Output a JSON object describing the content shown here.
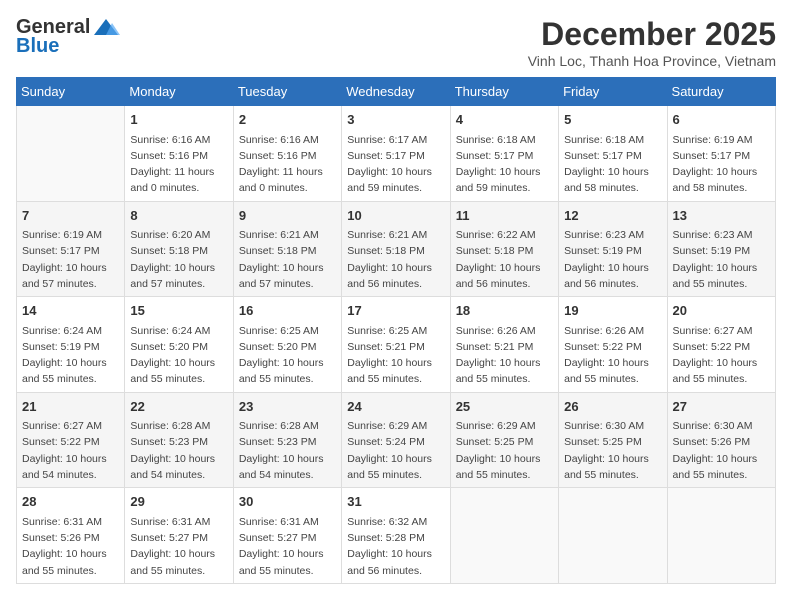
{
  "header": {
    "logo_general": "General",
    "logo_blue": "Blue",
    "month_title": "December 2025",
    "subtitle": "Vinh Loc, Thanh Hoa Province, Vietnam"
  },
  "days_of_week": [
    "Sunday",
    "Monday",
    "Tuesday",
    "Wednesday",
    "Thursday",
    "Friday",
    "Saturday"
  ],
  "weeks": [
    [
      {
        "day": "",
        "info": ""
      },
      {
        "day": "1",
        "info": "Sunrise: 6:16 AM\nSunset: 5:16 PM\nDaylight: 11 hours\nand 0 minutes."
      },
      {
        "day": "2",
        "info": "Sunrise: 6:16 AM\nSunset: 5:16 PM\nDaylight: 11 hours\nand 0 minutes."
      },
      {
        "day": "3",
        "info": "Sunrise: 6:17 AM\nSunset: 5:17 PM\nDaylight: 10 hours\nand 59 minutes."
      },
      {
        "day": "4",
        "info": "Sunrise: 6:18 AM\nSunset: 5:17 PM\nDaylight: 10 hours\nand 59 minutes."
      },
      {
        "day": "5",
        "info": "Sunrise: 6:18 AM\nSunset: 5:17 PM\nDaylight: 10 hours\nand 58 minutes."
      },
      {
        "day": "6",
        "info": "Sunrise: 6:19 AM\nSunset: 5:17 PM\nDaylight: 10 hours\nand 58 minutes."
      }
    ],
    [
      {
        "day": "7",
        "info": "Sunrise: 6:19 AM\nSunset: 5:17 PM\nDaylight: 10 hours\nand 57 minutes."
      },
      {
        "day": "8",
        "info": "Sunrise: 6:20 AM\nSunset: 5:18 PM\nDaylight: 10 hours\nand 57 minutes."
      },
      {
        "day": "9",
        "info": "Sunrise: 6:21 AM\nSunset: 5:18 PM\nDaylight: 10 hours\nand 57 minutes."
      },
      {
        "day": "10",
        "info": "Sunrise: 6:21 AM\nSunset: 5:18 PM\nDaylight: 10 hours\nand 56 minutes."
      },
      {
        "day": "11",
        "info": "Sunrise: 6:22 AM\nSunset: 5:18 PM\nDaylight: 10 hours\nand 56 minutes."
      },
      {
        "day": "12",
        "info": "Sunrise: 6:23 AM\nSunset: 5:19 PM\nDaylight: 10 hours\nand 56 minutes."
      },
      {
        "day": "13",
        "info": "Sunrise: 6:23 AM\nSunset: 5:19 PM\nDaylight: 10 hours\nand 55 minutes."
      }
    ],
    [
      {
        "day": "14",
        "info": "Sunrise: 6:24 AM\nSunset: 5:19 PM\nDaylight: 10 hours\nand 55 minutes."
      },
      {
        "day": "15",
        "info": "Sunrise: 6:24 AM\nSunset: 5:20 PM\nDaylight: 10 hours\nand 55 minutes."
      },
      {
        "day": "16",
        "info": "Sunrise: 6:25 AM\nSunset: 5:20 PM\nDaylight: 10 hours\nand 55 minutes."
      },
      {
        "day": "17",
        "info": "Sunrise: 6:25 AM\nSunset: 5:21 PM\nDaylight: 10 hours\nand 55 minutes."
      },
      {
        "day": "18",
        "info": "Sunrise: 6:26 AM\nSunset: 5:21 PM\nDaylight: 10 hours\nand 55 minutes."
      },
      {
        "day": "19",
        "info": "Sunrise: 6:26 AM\nSunset: 5:22 PM\nDaylight: 10 hours\nand 55 minutes."
      },
      {
        "day": "20",
        "info": "Sunrise: 6:27 AM\nSunset: 5:22 PM\nDaylight: 10 hours\nand 55 minutes."
      }
    ],
    [
      {
        "day": "21",
        "info": "Sunrise: 6:27 AM\nSunset: 5:22 PM\nDaylight: 10 hours\nand 54 minutes."
      },
      {
        "day": "22",
        "info": "Sunrise: 6:28 AM\nSunset: 5:23 PM\nDaylight: 10 hours\nand 54 minutes."
      },
      {
        "day": "23",
        "info": "Sunrise: 6:28 AM\nSunset: 5:23 PM\nDaylight: 10 hours\nand 54 minutes."
      },
      {
        "day": "24",
        "info": "Sunrise: 6:29 AM\nSunset: 5:24 PM\nDaylight: 10 hours\nand 55 minutes."
      },
      {
        "day": "25",
        "info": "Sunrise: 6:29 AM\nSunset: 5:25 PM\nDaylight: 10 hours\nand 55 minutes."
      },
      {
        "day": "26",
        "info": "Sunrise: 6:30 AM\nSunset: 5:25 PM\nDaylight: 10 hours\nand 55 minutes."
      },
      {
        "day": "27",
        "info": "Sunrise: 6:30 AM\nSunset: 5:26 PM\nDaylight: 10 hours\nand 55 minutes."
      }
    ],
    [
      {
        "day": "28",
        "info": "Sunrise: 6:31 AM\nSunset: 5:26 PM\nDaylight: 10 hours\nand 55 minutes."
      },
      {
        "day": "29",
        "info": "Sunrise: 6:31 AM\nSunset: 5:27 PM\nDaylight: 10 hours\nand 55 minutes."
      },
      {
        "day": "30",
        "info": "Sunrise: 6:31 AM\nSunset: 5:27 PM\nDaylight: 10 hours\nand 55 minutes."
      },
      {
        "day": "31",
        "info": "Sunrise: 6:32 AM\nSunset: 5:28 PM\nDaylight: 10 hours\nand 56 minutes."
      },
      {
        "day": "",
        "info": ""
      },
      {
        "day": "",
        "info": ""
      },
      {
        "day": "",
        "info": ""
      }
    ]
  ]
}
